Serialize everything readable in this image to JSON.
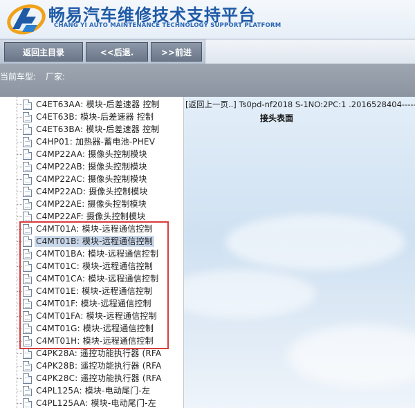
{
  "header": {
    "title_cn": "畅易汽车维修技术支持平台",
    "title_en": "CHANG YI AUTO MAINTENANCE TECHNOLOGY SUPPORT PLATFORM"
  },
  "toolbar": {
    "home_label": "返回主目录",
    "back_label": "<<后退.",
    "forward_label": ">>前进"
  },
  "infobar": {
    "vehicle_label": "当前车型:",
    "maker_label": "厂家:"
  },
  "tree": {
    "items": [
      {
        "label": "C4ET63AA: 模块-后差速器 控制"
      },
      {
        "label": "C4ET63B: 模块-后差速器 控制"
      },
      {
        "label": "C4ET63BA: 模块-后差速器 控制"
      },
      {
        "label": "C4HP01: 加热器-蓄电池-PHEV"
      },
      {
        "label": "C4MP22AA: 摄像头控制模块"
      },
      {
        "label": "C4MP22AB: 摄像头控制模块"
      },
      {
        "label": "C4MP22AC: 摄像头控制模块"
      },
      {
        "label": "C4MP22AD: 摄像头控制模块"
      },
      {
        "label": "C4MP22AE: 摄像头控制模块"
      },
      {
        "label": "C4MP22AF: 摄像头控制模块"
      },
      {
        "label": "C4MT01A: 模块-远程通信控制"
      },
      {
        "label": "C4MT01B: 模块-远程通信控制"
      },
      {
        "label": "C4MT01BA: 模块-远程通信控制"
      },
      {
        "label": "C4MT01C: 模块-远程通信控制"
      },
      {
        "label": "C4MT01CA: 模块-远程通信控制"
      },
      {
        "label": "C4MT01E: 模块-远程通信控制"
      },
      {
        "label": "C4MT01F: 模块-远程通信控制"
      },
      {
        "label": "C4MT01FA: 模块-远程通信控制"
      },
      {
        "label": "C4MT01G: 模块-远程通信控制"
      },
      {
        "label": "C4MT01H: 模块-远程通信控制"
      },
      {
        "label": "C4PK28A: 遥控功能执行器 (RFA"
      },
      {
        "label": "C4PK28B: 遥控功能执行器 (RFA"
      },
      {
        "label": "C4PK28C: 遥控功能执行器 (RFA"
      },
      {
        "label": "C4PL125A: 模块-电动尾门-左"
      },
      {
        "label": "C4PL125AA: 模块-电动尾门-左"
      }
    ],
    "selected_index": 11
  },
  "doc": {
    "path": "[返回上一页..] Ts0pd-nf2018 S-1NO:2PC:1 .2016528404-----",
    "title": "接头表面"
  },
  "colors": {
    "brand_blue": "#1f5aa6",
    "highlight_red": "#d83c3c",
    "selection_bg": "#c9d7ea"
  }
}
